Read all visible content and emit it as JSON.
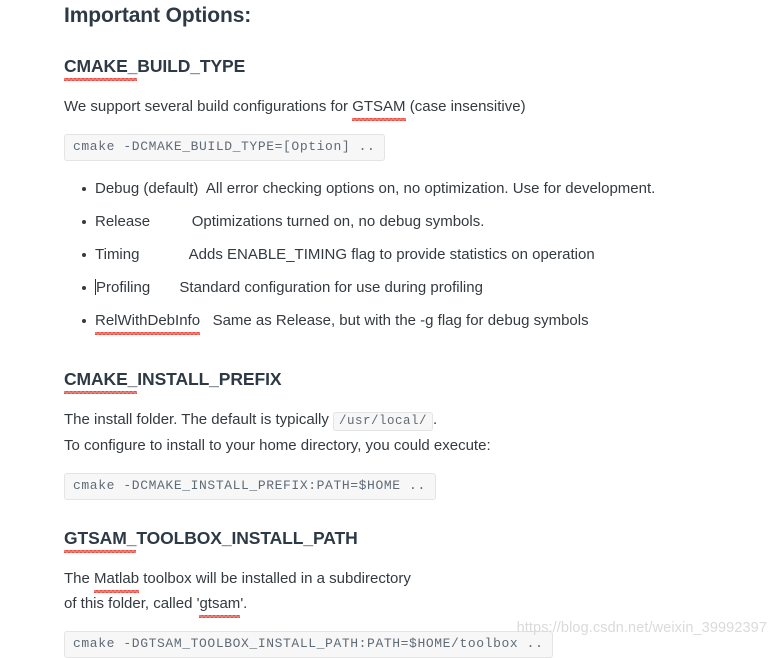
{
  "document": {
    "title": "Important Options:",
    "sections": [
      {
        "heading": "CMAKE_BUILD_TYPE",
        "heading_misspelled_part": "CMAKE_",
        "heading_rest": "BUILD_TYPE",
        "intro_prefix": "We support several build configurations for ",
        "intro_misspelled": "GTSAM",
        "intro_suffix": " (case insensitive)",
        "code": "cmake -DCMAKE_BUILD_TYPE=[Option] ..",
        "options": [
          {
            "name": "Debug (default)",
            "description": "All error checking options on, no optimization. Use for development.",
            "misspelled": false,
            "caret": false,
            "gap": "  "
          },
          {
            "name": "Release",
            "description": "Optimizations turned on, no debug symbols.",
            "misspelled": false,
            "caret": false,
            "gap": "          "
          },
          {
            "name": "Timing",
            "description": "Adds ENABLE_TIMING flag to provide statistics on operation",
            "misspelled": false,
            "caret": false,
            "gap": "            "
          },
          {
            "name": "Profiling",
            "description": "Standard configuration for use during profiling",
            "misspelled": false,
            "caret": true,
            "gap": "       "
          },
          {
            "name": "RelWithDebInfo",
            "description": "Same as Release, but with the -g flag for debug symbols",
            "misspelled": true,
            "caret": false,
            "gap": "   "
          }
        ]
      },
      {
        "heading": "CMAKE_INSTALL_PREFIX",
        "heading_misspelled_part": "CMAKE_",
        "heading_rest": "INSTALL_PREFIX",
        "para1_prefix": "The install folder. The default is typically ",
        "para1_code": "/usr/local/",
        "para1_suffix": ".",
        "para2": "To configure to install to your home directory, you could execute:",
        "code": "cmake -DCMAKE_INSTALL_PREFIX:PATH=$HOME .."
      },
      {
        "heading": "GTSAM_TOOLBOX_INSTALL_PATH",
        "heading_misspelled_part": "GTSAM_",
        "heading_rest": "TOOLBOX_INSTALL_PATH",
        "para1_prefix": "The ",
        "para1_misspelled": "Matlab",
        "para1_suffix": " toolbox will be installed in a subdirectory",
        "para2_prefix": "of this folder, called '",
        "para2_misspelled": "gtsam",
        "para2_suffix": "'.",
        "code": "cmake -DGTSAM_TOOLBOX_INSTALL_PATH:PATH=$HOME/toolbox .."
      }
    ]
  },
  "watermark": {
    "text": "https://blog.csdn.net/weixin_39992397"
  },
  "colors": {
    "heading": "#2d3a45",
    "body": "#333a40",
    "code_text": "#5f6b77",
    "code_bg": "#f7f7f7",
    "code_border": "#e4e4e4",
    "spellcheck_underline": "#e8453c",
    "watermark": "#d8dadc"
  }
}
